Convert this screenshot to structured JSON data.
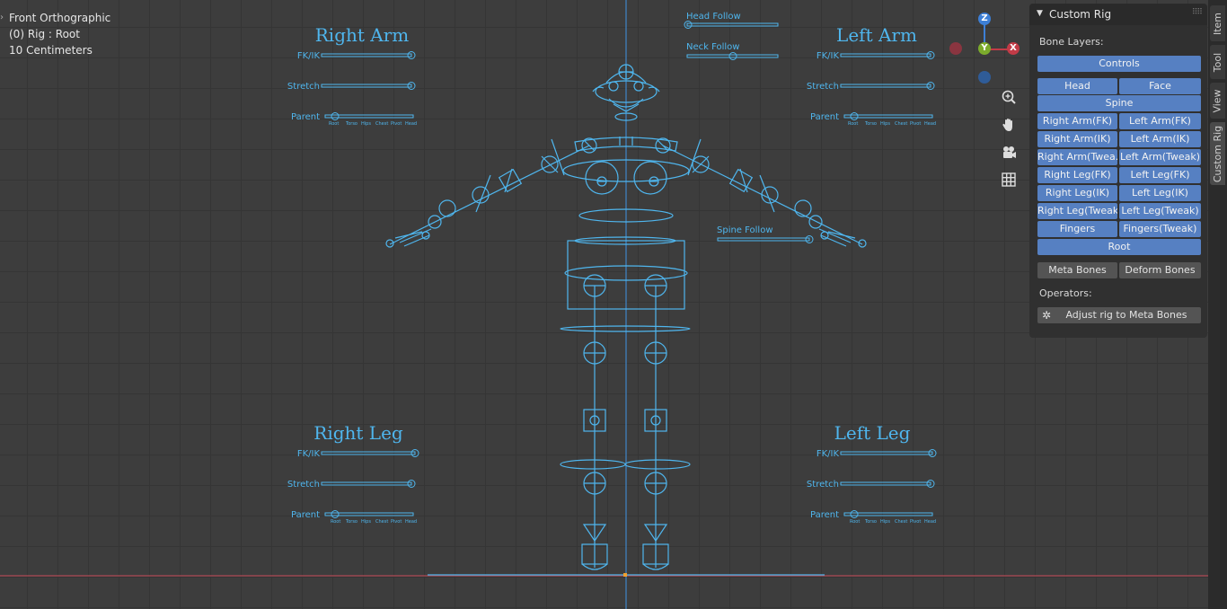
{
  "viewport": {
    "view_name": "Front Orthographic",
    "object_info": "(0) Rig : Root",
    "scale_info": "10 Centimeters"
  },
  "gizmo": {
    "z_label": "Z",
    "y_label": "Y",
    "x_label": "X"
  },
  "nav_buttons": [
    "zoom-icon",
    "hand-pan-icon",
    "camera-icon",
    "grid-icon"
  ],
  "widgets": {
    "right_arm": {
      "title": "Right Arm",
      "fkik": "FK/IK",
      "stretch": "Stretch",
      "parent": "Parent"
    },
    "left_arm": {
      "title": "Left Arm",
      "fkik": "FK/IK",
      "stretch": "Stretch",
      "parent": "Parent"
    },
    "right_leg": {
      "title": "Right Leg",
      "fkik": "FK/IK",
      "stretch": "Stretch",
      "parent": "Parent"
    },
    "left_leg": {
      "title": "Left Leg",
      "fkik": "FK/IK",
      "stretch": "Stretch",
      "parent": "Parent"
    },
    "parent_ticks": [
      "Root",
      "Torso",
      "Hips",
      "Chest",
      "Pivot",
      "Head"
    ],
    "head_follow": "Head Follow",
    "neck_follow": "Neck Follow",
    "spine_follow": "Spine Follow"
  },
  "panel": {
    "title": "Custom Rig",
    "bone_layers_label": "Bone Layers:",
    "controls": "Controls",
    "head": "Head",
    "face": "Face",
    "spine": "Spine",
    "right_arm_fk": "Right Arm(FK)",
    "left_arm_fk": "Left Arm(FK)",
    "right_arm_ik": "Right Arm(IK)",
    "left_arm_ik": "Left Arm(IK)",
    "right_arm_tweak": "Right Arm(Twea...",
    "left_arm_tweak": "Left Arm(Tweak)",
    "right_leg_fk": "Right Leg(FK)",
    "left_leg_fk": "Left Leg(FK)",
    "right_leg_ik": "Right Leg(IK)",
    "left_leg_ik": "Left Leg(IK)",
    "right_leg_tweak": "Right Leg(Tweak)",
    "left_leg_tweak": "Left Leg(Tweak)",
    "fingers": "Fingers",
    "fingers_tweak": "Fingers(Tweak)",
    "root": "Root",
    "meta_bones": "Meta Bones",
    "deform_bones": "Deform Bones",
    "operators_label": "Operators:",
    "adjust_rig": "Adjust rig to Meta Bones"
  },
  "sidebar_tabs": [
    "Item",
    "Tool",
    "View",
    "Custom Rig"
  ],
  "colors": {
    "rig_blue": "#4fb6ee",
    "button_blue": "#5680c2",
    "x_axis": "#c23b47",
    "y_axis": "#7cab2c",
    "z_axis": "#3d7fd6"
  }
}
